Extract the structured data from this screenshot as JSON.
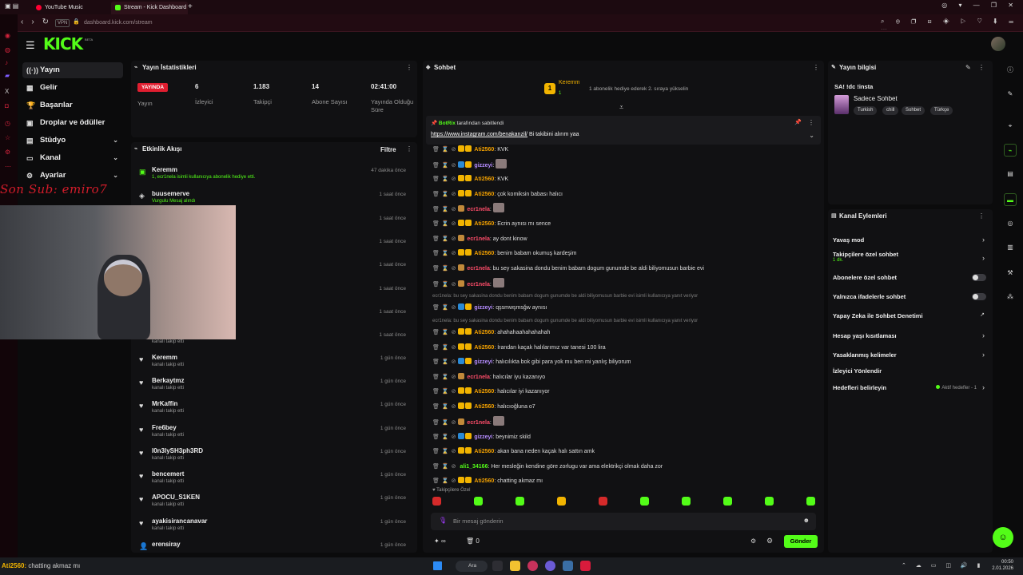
{
  "browser": {
    "tabs": [
      {
        "label": "YouTube Music"
      },
      {
        "label": "Stream - Kick Dashboard"
      }
    ],
    "url": "dashboard.kick.com/stream",
    "vpn_label": "VPN"
  },
  "kick": {
    "logo": "KICK",
    "logo_badge": "BETA"
  },
  "nav": [
    {
      "label": "Yayın",
      "icon": "broadcast-icon",
      "active": true
    },
    {
      "label": "Gelir",
      "icon": "money-icon"
    },
    {
      "label": "Başarılar",
      "icon": "trophy-icon"
    },
    {
      "label": "Droplar ve ödüller",
      "icon": "gift-icon"
    },
    {
      "label": "Stüdyo",
      "icon": "studio-icon",
      "expandable": true
    },
    {
      "label": "Kanal",
      "icon": "channel-icon",
      "expandable": true
    },
    {
      "label": "Ayarlar",
      "icon": "settings-icon",
      "expandable": true
    }
  ],
  "overlay": {
    "sub_text": "Son Sub: emiro7",
    "chat_user": "Ati2560:",
    "chat_text": "chatting akmaz mı"
  },
  "stats": {
    "title": "Yayın İstatistikleri",
    "live_badge": "YAYINDA",
    "items": [
      {
        "value": "",
        "label": "Yayın"
      },
      {
        "value": "6",
        "label": "İzleyici"
      },
      {
        "value": "1.183",
        "label": "Takipçi"
      },
      {
        "value": "14",
        "label": "Abone Sayısı"
      },
      {
        "value": "02:41:00",
        "label": "Yayında Olduğu Süre"
      }
    ]
  },
  "activity": {
    "title": "Etkinlik Akışı",
    "filter_label": "Filtre",
    "items": [
      {
        "name": "Keremm",
        "desc": "1, ecr1nela isimli kullanıcıya abonelik hediye etti.",
        "time": "47 dakika önce",
        "icon": "gift-sub-icon"
      },
      {
        "name": "buusemerve",
        "desc": "Vurgulu Mesaj alındı",
        "time": "1 saat önce",
        "icon": "highlight-icon"
      },
      {
        "name": "",
        "desc": "",
        "time": "1 saat önce",
        "icon": "heart-icon"
      },
      {
        "name": "",
        "desc": "",
        "time": "1 saat önce",
        "icon": "heart-icon"
      },
      {
        "name": "",
        "desc": "",
        "time": "1 saat önce",
        "icon": "heart-icon"
      },
      {
        "name": "",
        "desc": "",
        "time": "1 saat önce",
        "icon": "heart-icon"
      },
      {
        "name": "",
        "desc": "",
        "time": "1 saat önce",
        "icon": "heart-icon"
      },
      {
        "name": "",
        "desc": "kanalı takip etti",
        "time": "1 saat önce",
        "icon": "heart-icon"
      },
      {
        "name": "Keremm",
        "desc": "kanalı takip etti",
        "time": "1 gün önce",
        "icon": "heart-icon"
      },
      {
        "name": "Berkaytmz",
        "desc": "kanalı takip etti",
        "time": "1 gün önce",
        "icon": "heart-icon"
      },
      {
        "name": "MrKaffin",
        "desc": "kanalı takip etti",
        "time": "1 gün önce",
        "icon": "heart-icon"
      },
      {
        "name": "Fre6bey",
        "desc": "kanalı takip etti",
        "time": "1 gün önce",
        "icon": "heart-icon"
      },
      {
        "name": "I0n3lySH3ph3RD",
        "desc": "kanalı takip etti",
        "time": "1 gün önce",
        "icon": "heart-icon"
      },
      {
        "name": "bencemert",
        "desc": "kanalı takip etti",
        "time": "1 gün önce",
        "icon": "heart-icon"
      },
      {
        "name": "APOCU_S1KEN",
        "desc": "kanalı takip etti",
        "time": "1 gün önce",
        "icon": "heart-icon"
      },
      {
        "name": "ayakisirancanavar",
        "desc": "kanalı takip etti",
        "time": "1 gün önce",
        "icon": "heart-icon"
      },
      {
        "name": "erensiray",
        "desc": "",
        "time": "1 gün önce",
        "icon": "user-icon"
      }
    ]
  },
  "chat": {
    "title": "Sohbet",
    "top_gifter": {
      "name": "Keremm",
      "count": "1",
      "badge": "1",
      "message": "1 abonelik hediye ederek 2. sıraya yükselin"
    },
    "pinned": {
      "by": "BotRix",
      "by_suffix": "tarafından sabitlendi",
      "link": "https://www.instagram.com/benakanzil/",
      "text": " Bi takibini alırım yaa"
    },
    "lines": [
      {
        "user": "Ati2560",
        "color": "#f2a000",
        "text": "KVK",
        "badges": [
          "#f2b400",
          "#f2b400"
        ]
      },
      {
        "user": "gizzeyi",
        "color": "#b58cff",
        "text": "[emote]",
        "badges": [
          "#2a8ad6",
          "#f2b400"
        ]
      },
      {
        "user": "Ati2560",
        "color": "#f2a000",
        "text": "KVK",
        "badges": [
          "#f2b400",
          "#f2b400"
        ]
      },
      {
        "user": "Ati2560",
        "color": "#f2a000",
        "text": "çok komiksin babası halıcı",
        "badges": [
          "#f2b400",
          "#f2b400"
        ]
      },
      {
        "user": "ecr1nela",
        "color": "#ff4d6a",
        "text": "[emote]",
        "badges": [
          "#c28a3a"
        ]
      },
      {
        "user": "Ati2560",
        "color": "#f2a000",
        "text": "Ecrin aynısı mı sence",
        "badges": [
          "#f2b400",
          "#f2b400"
        ]
      },
      {
        "user": "ecr1nela",
        "color": "#ff4d6a",
        "text": "ay dont kinow",
        "badges": [
          "#c28a3a"
        ]
      },
      {
        "user": "Ati2560",
        "color": "#f2a000",
        "text": "benim babam okumuş kardeşim",
        "badges": [
          "#f2b400",
          "#f2b400"
        ]
      },
      {
        "user": "ecr1nela",
        "color": "#ff4d6a",
        "text": "bu sey sakasina dondu benim babam dogum gunumde be aldi biliyomusun barbie evi",
        "badges": [
          "#c28a3a"
        ]
      },
      {
        "user": "ecr1nela",
        "color": "#ff4d6a",
        "text": "[emote]",
        "badges": [
          "#c28a3a"
        ]
      },
      {
        "user": "gizzeyi",
        "color": "#b58cff",
        "text": "qşsmwşmsğw aynısı",
        "badges": [
          "#2a8ad6",
          "#f2b400"
        ],
        "reply": "ecr1nela: bu sey sakasina dondu benim babam dogum gunumde be aldi biliyomusun barbie evi isimli kullanıcıya yanıt veriyor"
      },
      {
        "user": "Ati2560",
        "color": "#f2a000",
        "text": "ahahahaahahahahah",
        "badges": [
          "#f2b400",
          "#f2b400"
        ],
        "reply": "ecr1nela: bu sey sakasina dondu benim babam dogum gunumde be aldi biliyomusun barbie evi isimli kullanıcıya yanıt veriyor"
      },
      {
        "user": "Ati2560",
        "color": "#f2a000",
        "text": "İrandan kaçak halılarımız var tanesi 100 lira",
        "badges": [
          "#f2b400",
          "#f2b400"
        ]
      },
      {
        "user": "gizzeyi",
        "color": "#b58cff",
        "text": "halıcılıkta bok gibi para yok mu ben mi yanlış biliyorum",
        "badges": [
          "#2a8ad6",
          "#f2b400"
        ]
      },
      {
        "user": "ecr1nela",
        "color": "#ff4d6a",
        "text": "halıcılar iyu kazanıyo",
        "badges": [
          "#c28a3a"
        ]
      },
      {
        "user": "Ati2560",
        "color": "#f2a000",
        "text": "halıcılar iyi kazanıyor",
        "badges": [
          "#f2b400",
          "#f2b400"
        ]
      },
      {
        "user": "Ati2560",
        "color": "#f2a000",
        "text": "halıcıoğluna o7",
        "badges": [
          "#f2b400",
          "#f2b400"
        ]
      },
      {
        "user": "ecr1nela",
        "color": "#ff4d6a",
        "text": "[emote]",
        "badges": [
          "#c28a3a"
        ]
      },
      {
        "user": "gizzeyi",
        "color": "#b58cff",
        "text": "beynimiz skild",
        "badges": [
          "#2a8ad6",
          "#f2b400"
        ]
      },
      {
        "user": "Ati2560",
        "color": "#f2a000",
        "text": "akan bana neden kaçak halı sattın amk",
        "badges": [
          "#f2b400",
          "#f2b400"
        ]
      },
      {
        "user": "ali1_34166",
        "color": "#53fc18",
        "text": "Her mesleğin kendine göre zorlugu var ama elektrikçi olmak daha zor",
        "badges": []
      },
      {
        "user": "Ati2560",
        "color": "#f2a000",
        "text": "chatting akmaz mı",
        "badges": [
          "#f2b400",
          "#f2b400"
        ]
      }
    ],
    "followers_only_label": "Takipçilere Özel",
    "input_placeholder": "Bir mesaj gönderin",
    "infinity_label": "∞",
    "points_value": "0",
    "send_label": "Gönder"
  },
  "info": {
    "title": "Yayın bilgisi",
    "stream_title": "SA! !dc !insta",
    "category": "Sadece Sohbet",
    "tags": [
      "Turkish",
      "chill",
      "Sohbet",
      "Türkçe"
    ]
  },
  "actions": {
    "title": "Kanal Eylemleri",
    "items": [
      {
        "label": "Yavaş mod",
        "type": "chevron"
      },
      {
        "label": "Takipçilere özel sohbet",
        "sub": "1 dk.",
        "type": "chevron"
      },
      {
        "label": "Abonelere özel sohbet",
        "type": "toggle"
      },
      {
        "label": "Yalnızca ifadelerle sohbet",
        "type": "toggle"
      },
      {
        "label": "Yapay Zeka ile Sohbet Denetimi",
        "type": "external"
      },
      {
        "label": "Hesap yaşı kısıtlaması",
        "type": "chevron"
      },
      {
        "label": "Yasaklanmış kelimeler",
        "type": "chevron"
      },
      {
        "label": "İzleyici Yönlendir",
        "type": "none"
      },
      {
        "label": "Hedefleri belirleyin",
        "type": "chevron",
        "extra": "Aktif hedefler - 1"
      }
    ]
  },
  "taskbar": {
    "search": "Ara",
    "time": "00:50",
    "date": "2.01.2026"
  },
  "colors": {
    "brand": "#53fc18",
    "live": "#e01e30",
    "background": "#0b0b0c",
    "panel": "#111113"
  }
}
